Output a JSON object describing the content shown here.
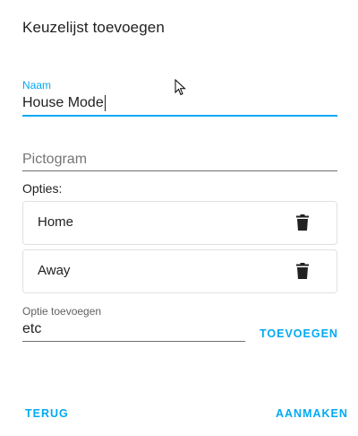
{
  "dialog": {
    "title": "Keuzelijst toevoegen"
  },
  "name_field": {
    "label": "Naam",
    "value": "House Mode"
  },
  "icon_field": {
    "placeholder": "Pictogram"
  },
  "options": {
    "label": "Opties:",
    "items": [
      {
        "label": "Home",
        "icon": "delete-icon"
      },
      {
        "label": "Away",
        "icon": "delete-icon"
      }
    ]
  },
  "add_option": {
    "label": "Optie toevoegen",
    "value": "etc",
    "button": "TOEVOEGEN"
  },
  "actions": {
    "back": "TERUG",
    "create": "AANMAKEN"
  },
  "colors": {
    "accent": "#03a9f4",
    "text": "#212121",
    "icon": "#212121",
    "border": "#e0e0e0"
  }
}
